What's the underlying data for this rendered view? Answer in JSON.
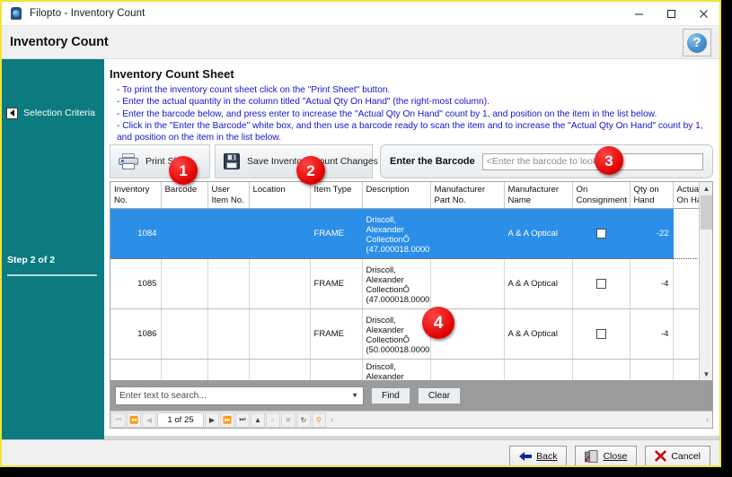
{
  "window": {
    "title": "Filopto - Inventory Count",
    "icon": "app-icon",
    "controls": {
      "minimize": "minimize-icon",
      "maximize": "maximize-icon",
      "close": "close-icon"
    }
  },
  "header": {
    "title": "Inventory Count",
    "help_label": "?"
  },
  "sidebar": {
    "selection_criteria_label": "Selection Criteria",
    "step_label": "Step 2 of 2",
    "accent_color": "#0b7b80"
  },
  "main": {
    "sheet_title": "Inventory Count Sheet",
    "instructions": [
      "- To print the inventory count sheet click on the \"Print Sheet\" button.",
      "- Enter the actual quantity in the column titled \"Actual Qty On Hand\" (the right-most column).",
      "- Enter the barcode below, and press enter to increase the \"Actual Qty On Hand\" count by 1, and position on the item in the list below.",
      "- Click in the \"Enter the Barcode\" white box, and then use a barcode ready to scan the item and to increase the \"Actual Qty On Hand\" count by 1, and position on the item in the list below."
    ],
    "instructions_color": "#1414d0"
  },
  "toolbar": {
    "print_label": "Print Sheet",
    "save_label": "Save Inventory Count Changes",
    "barcode_label": "Enter the Barcode",
    "barcode_placeholder": "<Enter the barcode to lookup>",
    "barcode_value": ""
  },
  "grid": {
    "columns": [
      "Inventory No.",
      "Barcode",
      "User Item No.",
      "Location",
      "Item Type",
      "Description",
      "Manufacturer Part No.",
      "Manufacturer Name",
      "On Consignment",
      "Qty on Hand",
      "Actual Qty On Hand"
    ],
    "rows": [
      {
        "selected": true,
        "inventory_no": "1084",
        "barcode": "",
        "user_item_no": "",
        "location": "",
        "item_type": "FRAME",
        "description": "Driscoll, Alexander CollectionÔ (47.000018.0000",
        "manufacturer_part_no": "",
        "manufacturer_name": "A & A Optical",
        "on_consignment": false,
        "qty_on_hand": "-22",
        "actual_qty_on_hand": ""
      },
      {
        "selected": false,
        "inventory_no": "1085",
        "barcode": "",
        "user_item_no": "",
        "location": "",
        "item_type": "FRAME",
        "description": "Driscoll, Alexander CollectionÔ (47.000018.0000",
        "manufacturer_part_no": "",
        "manufacturer_name": "A & A Optical",
        "on_consignment": false,
        "qty_on_hand": "-4",
        "actual_qty_on_hand": ""
      },
      {
        "selected": false,
        "inventory_no": "1086",
        "barcode": "",
        "user_item_no": "",
        "location": "",
        "item_type": "FRAME",
        "description": "Driscoll, Alexander CollectionÔ (50.000018.0000",
        "manufacturer_part_no": "",
        "manufacturer_name": "A & A Optical",
        "on_consignment": false,
        "qty_on_hand": "-4",
        "actual_qty_on_hand": ""
      },
      {
        "selected": false,
        "partial": true,
        "inventory_no": "",
        "barcode": "",
        "user_item_no": "",
        "location": "",
        "item_type": "",
        "description": "Driscoll, Alexander",
        "manufacturer_part_no": "",
        "manufacturer_name": "",
        "on_consignment": false,
        "qty_on_hand": "",
        "actual_qty_on_hand": ""
      }
    ],
    "selected_row_color": "#2b8fe8"
  },
  "grid_footer": {
    "search_placeholder": "Enter text to search...",
    "search_value": "",
    "find_label": "Find",
    "clear_label": "Clear"
  },
  "pager": {
    "position_label": "1 of 25",
    "first_icon": "first-page-icon",
    "prev_page_icon": "prev-page-icon",
    "prev_icon": "prev-record-icon",
    "next_icon": "next-record-icon",
    "next_page_icon": "next-page-icon",
    "last_icon": "last-page-icon",
    "add_icon": "add-record-icon",
    "accept_icon": "accept-edit-icon",
    "delete_icon": "delete-record-icon",
    "refresh_icon": "refresh-icon",
    "filter_icon": "filter-icon"
  },
  "footer": {
    "back_label": "Back",
    "close_label": "Close",
    "cancel_label": "Cancel"
  },
  "callouts": [
    {
      "number": "1"
    },
    {
      "number": "2"
    },
    {
      "number": "3"
    },
    {
      "number": "4"
    }
  ]
}
